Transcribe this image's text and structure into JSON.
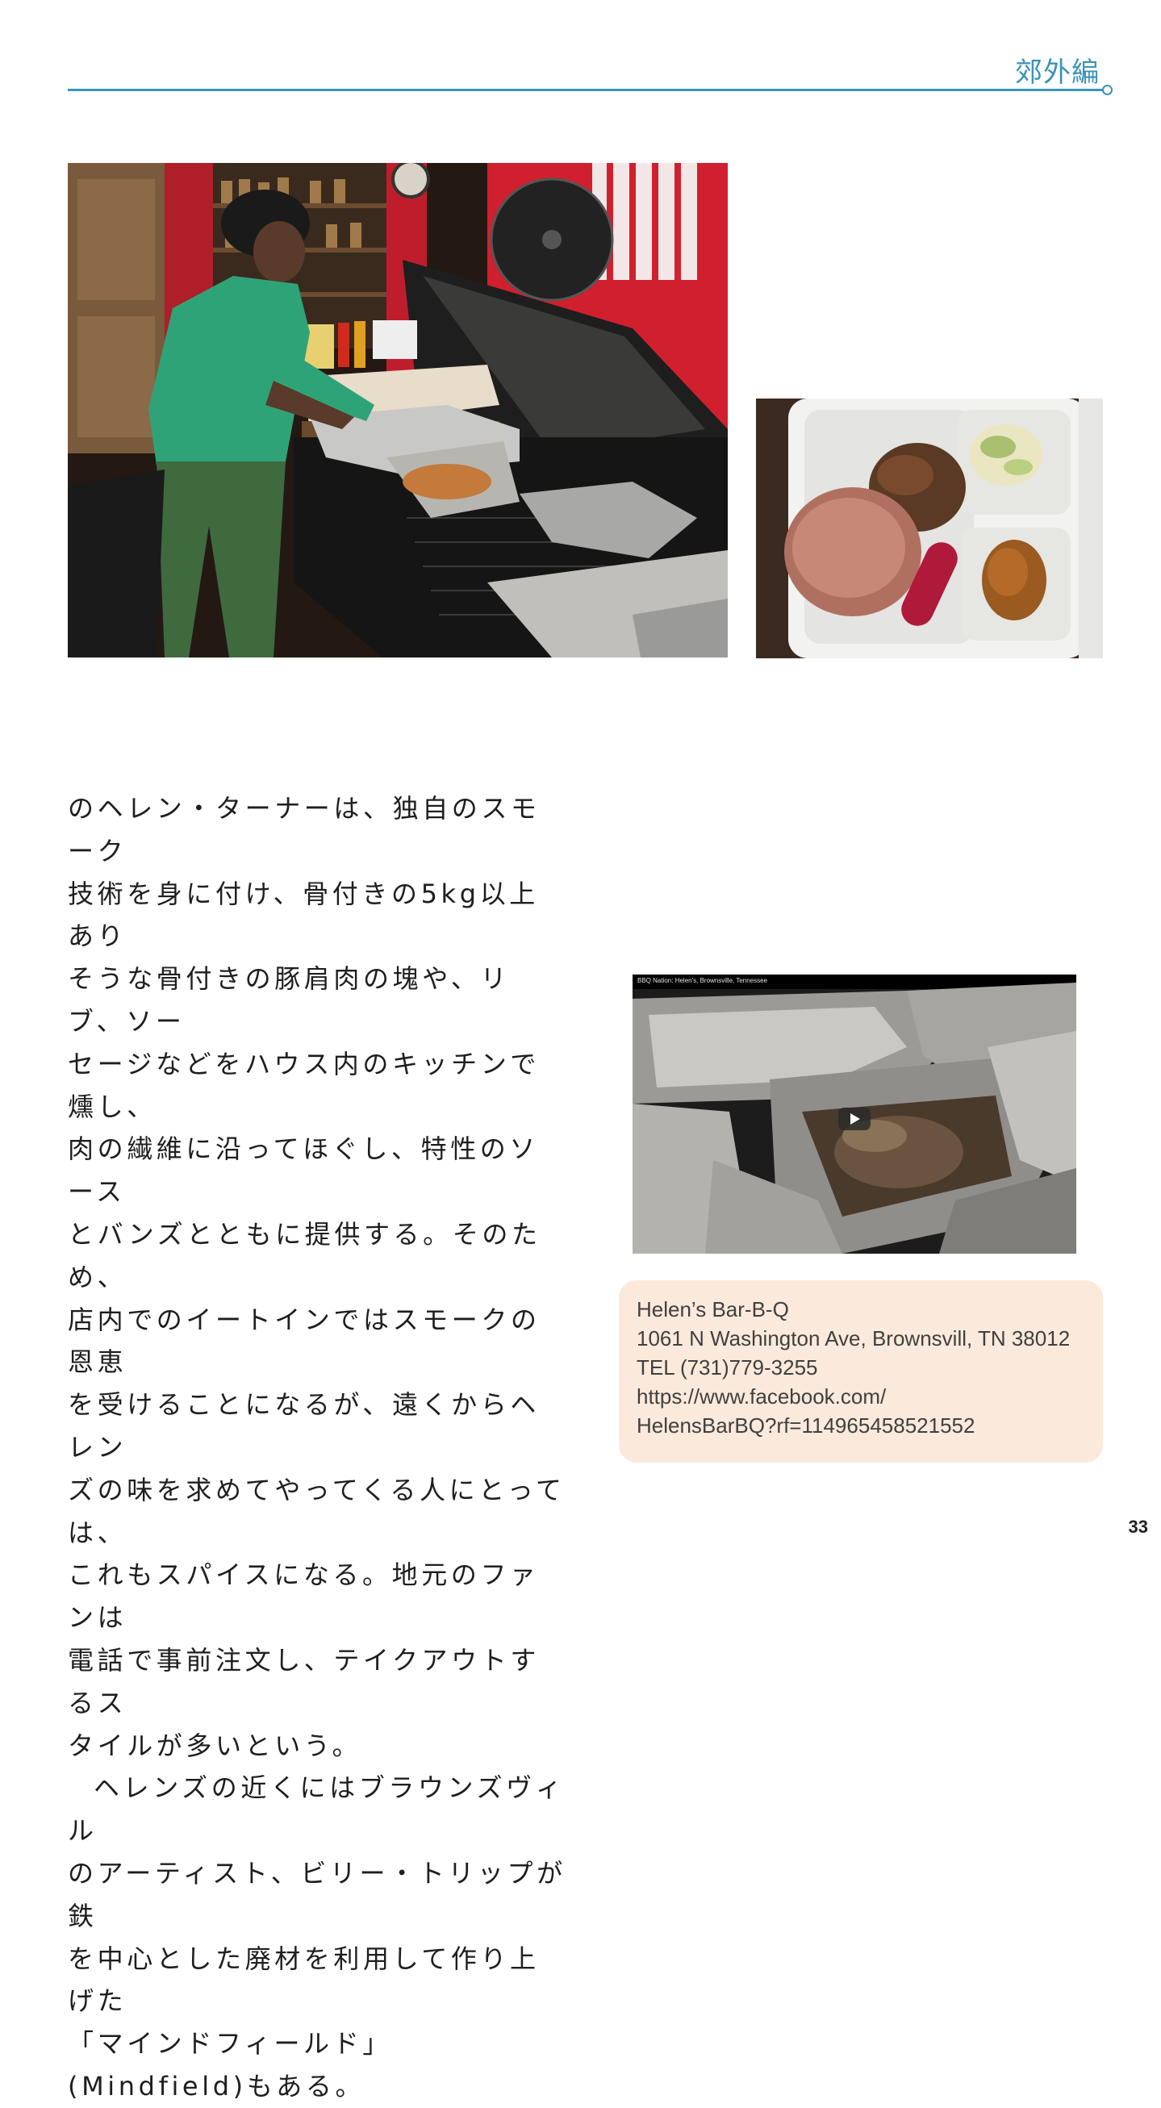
{
  "header": {
    "section_label": "郊外編",
    "accent_color": "#3a93b8"
  },
  "body": {
    "paragraph1": "のヘレン・ターナーは、独自のスモーク\n技術を身に付け、骨付きの5kg以上あり\nそうな骨付きの豚肩肉の塊や、リブ、ソー\nセージなどをハウス内のキッチンで燻し、\n肉の繊維に沿ってほぐし、特性のソース\nとバンズとともに提供する。そのため、\n店内でのイートインではスモークの恩恵\nを受けることになるが、遠くからヘレン\nズの味を求めてやってくる人にとっては、\nこれもスパイスになる。地元のファンは\n電話で事前注文し、テイクアウトするス\nタイルが多いという。",
    "paragraph2": "ヘレンズの近くにはブラウンズヴィル\nのアーティスト、ビリー・トリップが鉄\nを中心とした廃材を利用して作り上げた\n「マインドフィールド」(Mindfield)もある。"
  },
  "video": {
    "caption": "BBQ Nation: Helen's, Brownsville, Tennessee"
  },
  "info": {
    "name": "Helen’s Bar-B-Q",
    "address": "1061 N Washington Ave, Brownsvill, TN 38012",
    "tel": "TEL (731)779-3255",
    "url_line1": "https://www.facebook.com/",
    "url_line2": "HelensBarBQ?rf=114965458521552",
    "box_color": "#fbeadb"
  },
  "footer": {
    "page_number": "33"
  }
}
